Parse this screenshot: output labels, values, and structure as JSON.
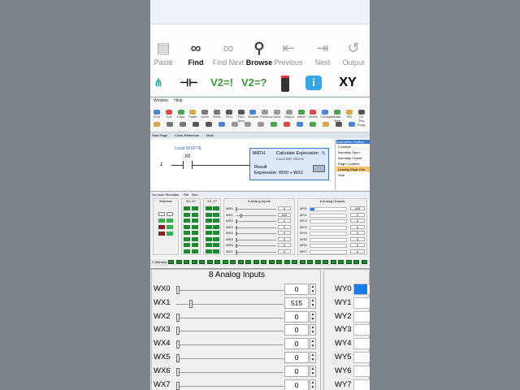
{
  "ribbon_top": {
    "buttons": [
      {
        "label": "Paste",
        "icon": "paste-icon",
        "active": false
      },
      {
        "label": "Find",
        "icon": "binoculars-icon",
        "active": true
      },
      {
        "label": "Find Next",
        "icon": "binoculars-next-icon",
        "active": false
      },
      {
        "label": "Browse",
        "icon": "magnifier-icon",
        "active": true
      },
      {
        "label": "Previous",
        "icon": "wire-previous-icon",
        "active": false
      },
      {
        "label": "Next",
        "icon": "wire-next-icon",
        "active": false
      },
      {
        "label": "Output",
        "icon": "output-icon",
        "active": false
      }
    ],
    "row2": [
      "V2=!",
      "V2=?",
      "XY"
    ]
  },
  "menu": [
    "Window",
    "Help"
  ],
  "toolbar_labels": [
    "Find",
    "Cut",
    "Copy",
    "Paste",
    "Undo",
    "Redo",
    "Find",
    "Find Next",
    "Browse",
    "Previous",
    "Next",
    "Output",
    "Insert",
    "Delete",
    "Configure",
    "Data View",
    "PID",
    "On This Rung"
  ],
  "tabs": [
    "Start Page",
    "Cross Reference",
    "Main"
  ],
  "ladder": {
    "rung": "1",
    "local_label": "Local SFUPTE",
    "contact": "X0",
    "math": {
      "type": "MATH",
      "caption": "Calculate Expression",
      "local": "Local WD WCH1",
      "result": "Result",
      "expression_label": "Expression",
      "expression": "WX0 + WX1"
    }
  },
  "side_panel": {
    "header": "Instruction Toolbox",
    "items": [
      "Contacts",
      "Normally Open",
      "Normally Closed",
      "Edge Contacts",
      "Leading Edge One Shot"
    ],
    "selected_index": 4
  },
  "sim": {
    "title": "Do-more Simulator",
    "menu": [
      "File",
      "Run"
    ],
    "panels": [
      "Switches",
      "X0..X7",
      "Y0..Y7",
      "8 Analog Inputs",
      "8 Analog Outputs"
    ],
    "mini_ai_labels": [
      "WX0",
      "WX1",
      "WX2",
      "WX3",
      "WX4",
      "WX5",
      "WX6",
      "WX7"
    ],
    "mini_ai_values": [
      "0",
      "515",
      "0",
      "0",
      "0",
      "0",
      "0",
      "0"
    ],
    "mini_ao_labels": [
      "WY0",
      "WY1",
      "WY2",
      "WY3",
      "WY4",
      "WY5",
      "WY6",
      "WY7"
    ],
    "mini_ao_values": [
      "493",
      "0",
      "0",
      "0",
      "0",
      "0",
      "0",
      "0"
    ],
    "status": "C Memory"
  },
  "analog_inputs": {
    "title": "8 Analog Inputs",
    "max": 4095,
    "channels": [
      {
        "label": "WX0",
        "value": "0"
      },
      {
        "label": "WX1",
        "value": "515"
      },
      {
        "label": "WX2",
        "value": "0"
      },
      {
        "label": "WX3",
        "value": "0"
      },
      {
        "label": "WX4",
        "value": "0"
      },
      {
        "label": "WX5",
        "value": "0"
      },
      {
        "label": "WX6",
        "value": "0"
      },
      {
        "label": "WX7",
        "value": "0"
      }
    ]
  },
  "analog_outputs": {
    "channels": [
      "WY0",
      "WY1",
      "WY2",
      "WY3",
      "WY4",
      "WY5",
      "WY6",
      "WY7"
    ],
    "active_color": "#1a7de6"
  }
}
